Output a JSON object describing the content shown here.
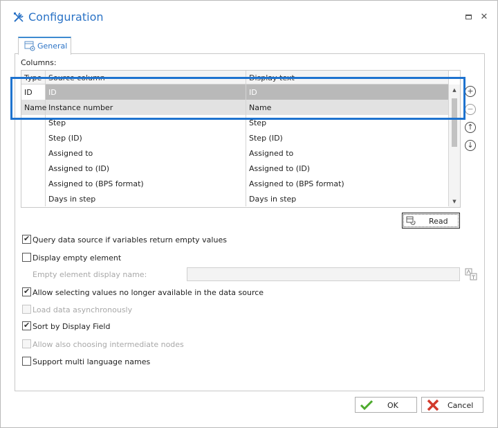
{
  "window": {
    "title": "Configuration",
    "title_icon": "tools-icon",
    "controls": [
      "maximize-icon",
      "close-icon"
    ],
    "accent_color": "#2b73c6",
    "highlight_color": "#1e73cf"
  },
  "tabs": [
    {
      "label": "General",
      "icon": "settings-panel-icon",
      "active": true
    }
  ],
  "columns_label": "Columns:",
  "grid": {
    "headers": [
      "Type",
      "Source column",
      "Display text"
    ],
    "rows": [
      {
        "type": "ID",
        "source": "ID",
        "display": "ID",
        "state": "selected"
      },
      {
        "type": "Name",
        "source": "Instance number",
        "display": "Name",
        "state": "highlighted"
      },
      {
        "type": "",
        "source": "Step",
        "display": "Step",
        "state": ""
      },
      {
        "type": "",
        "source": "Step (ID)",
        "display": "Step (ID)",
        "state": ""
      },
      {
        "type": "",
        "source": "Assigned to",
        "display": "Assigned to",
        "state": ""
      },
      {
        "type": "",
        "source": "Assigned to (ID)",
        "display": "Assigned to (ID)",
        "state": ""
      },
      {
        "type": "",
        "source": "Assigned to (BPS format)",
        "display": "Assigned to (BPS format)",
        "state": ""
      },
      {
        "type": "",
        "source": "Days in step",
        "display": "Days in step",
        "state": ""
      }
    ]
  },
  "side_buttons": [
    "add-icon",
    "remove-icon",
    "move-up-icon",
    "move-down-icon"
  ],
  "read_button": {
    "label": "Read",
    "icon": "read-icon"
  },
  "options": {
    "query_empty": {
      "label": "Query data source if variables return empty values",
      "checked": true,
      "enabled": true
    },
    "display_empty": {
      "label": "Display empty element",
      "checked": false,
      "enabled": true
    },
    "empty_name_label": "Empty element display name:",
    "empty_name_value": "",
    "allow_unavailable": {
      "label": "Allow selecting values no longer available in the data source",
      "checked": true,
      "enabled": true
    },
    "load_async": {
      "label": "Load data asynchronously",
      "checked": false,
      "enabled": false
    },
    "sort_display": {
      "label": "Sort by Display Field",
      "checked": true,
      "enabled": true
    },
    "intermediate": {
      "label": "Allow also choosing intermediate nodes",
      "checked": false,
      "enabled": false
    },
    "multi_language": {
      "label": "Support multi language names",
      "checked": false,
      "enabled": true
    }
  },
  "footer": {
    "ok_label": "OK",
    "cancel_label": "Cancel",
    "ok_icon": "check-icon",
    "cancel_icon": "cancel-x-icon"
  }
}
